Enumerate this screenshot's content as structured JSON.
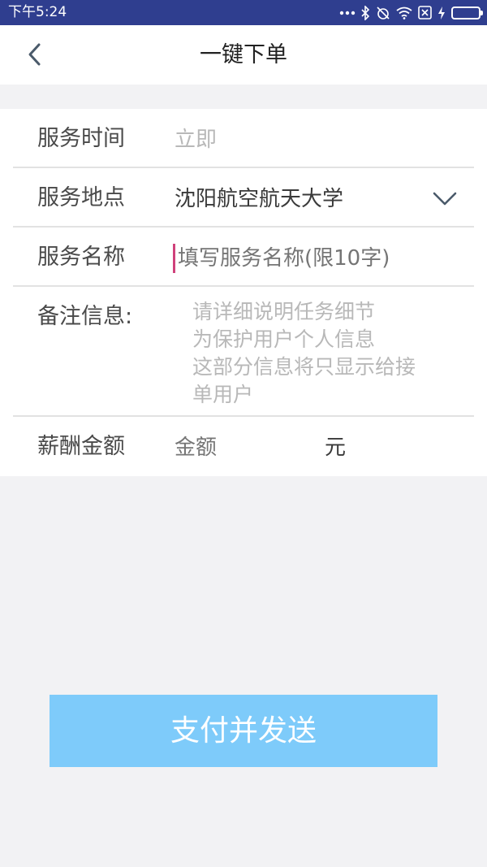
{
  "status_bar": {
    "time": "下午5:24",
    "icons": [
      "more-dots-icon",
      "bluetooth-icon",
      "alarm-off-icon",
      "wifi-icon",
      "no-sim-icon",
      "charging-icon",
      "battery-icon"
    ],
    "battery_color": "#38d34a",
    "background": "#2f3e8f"
  },
  "header": {
    "title": "一键下单",
    "back_icon": "chevron-left-icon"
  },
  "form": {
    "service_time": {
      "label": "服务时间",
      "value": "立即"
    },
    "service_location": {
      "label": "服务地点",
      "value": "沈阳航空航天大学",
      "dropdown_icon": "chevron-down-icon"
    },
    "service_name": {
      "label": "服务名称",
      "placeholder": "填写服务名称(限10字)"
    },
    "notes": {
      "label": "备注信息:",
      "placeholder_lines": [
        "请详细说明任务细节",
        "为保护用户个人信息",
        "这部分信息将只显示给接",
        "单用户"
      ]
    },
    "payment": {
      "label": "薪酬金额",
      "placeholder": "金额",
      "unit": "元"
    }
  },
  "submit_button": {
    "label": "支付并发送",
    "color": "#7ecbfa"
  }
}
